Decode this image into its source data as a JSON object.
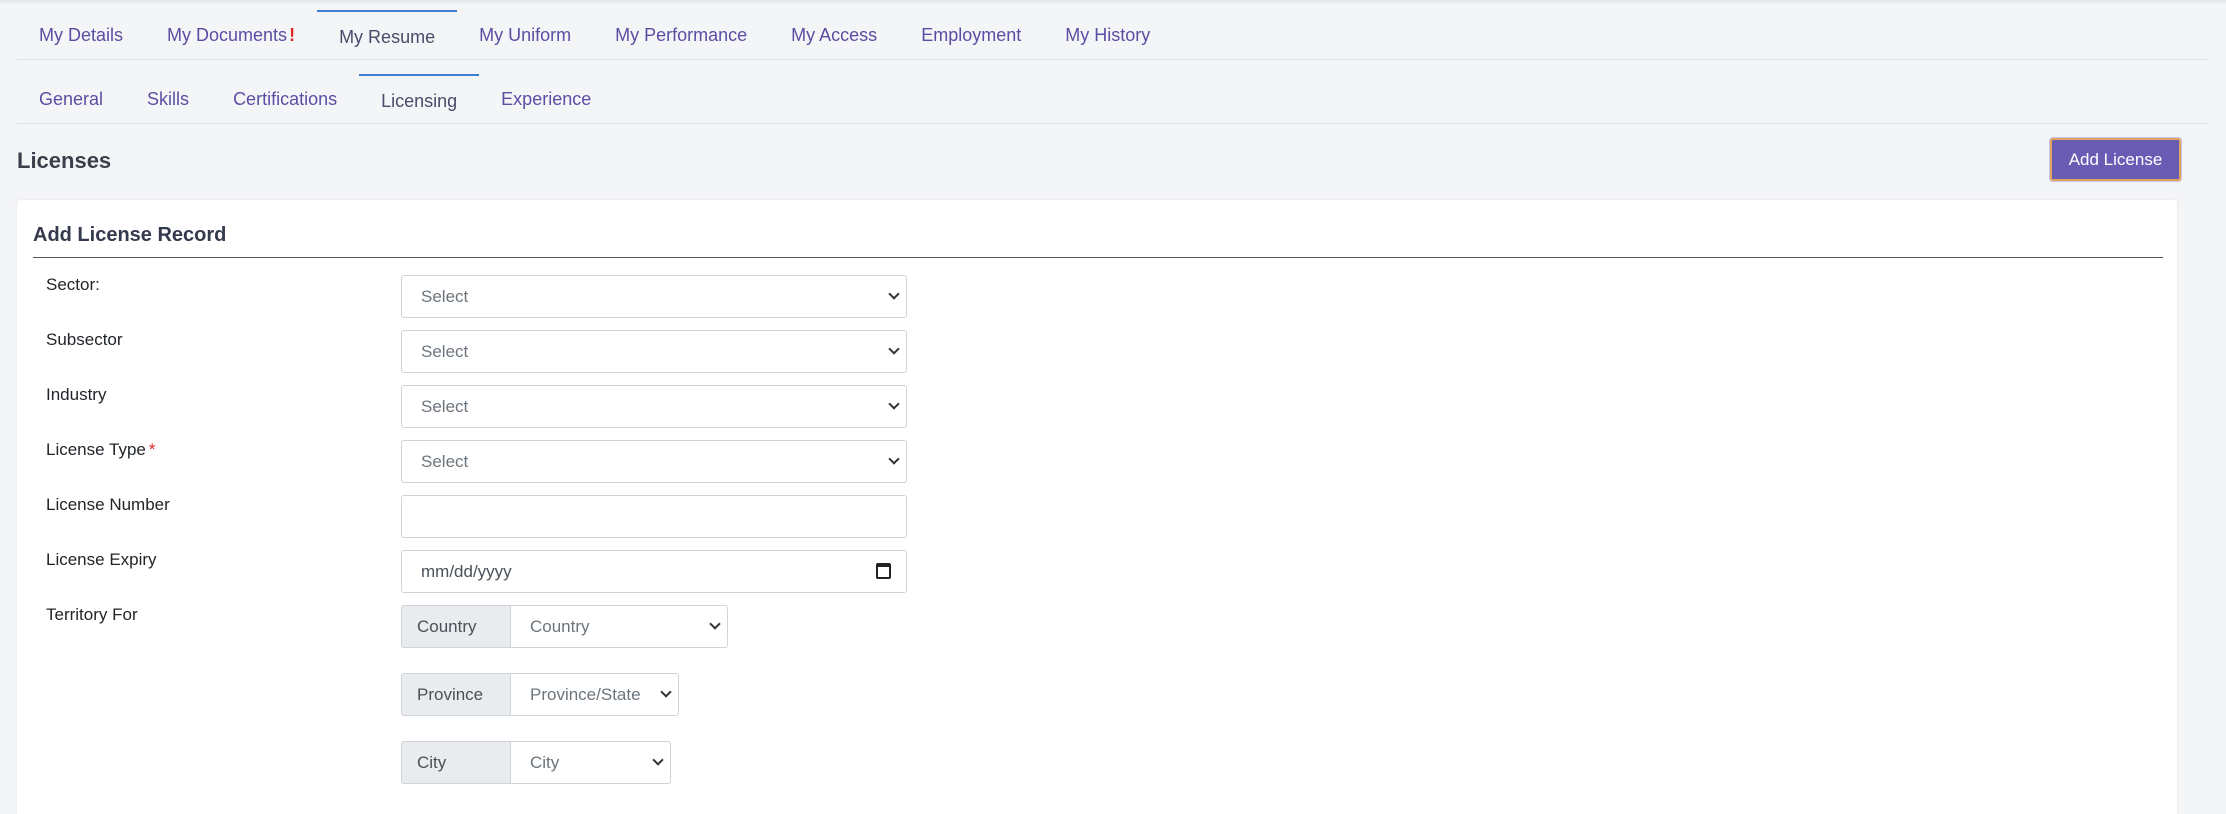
{
  "main_tabs": [
    {
      "label": "My Details"
    },
    {
      "label": "My Documents",
      "alert": "!"
    },
    {
      "label": "My Resume"
    },
    {
      "label": "My Uniform"
    },
    {
      "label": "My Performance"
    },
    {
      "label": "My Access"
    },
    {
      "label": "Employment"
    },
    {
      "label": "My History"
    }
  ],
  "main_active": "My Resume",
  "sub_tabs": [
    {
      "label": "General"
    },
    {
      "label": "Skills"
    },
    {
      "label": "Certifications"
    },
    {
      "label": "Licensing"
    },
    {
      "label": "Experience"
    }
  ],
  "sub_active": "Licensing",
  "section": {
    "title": "Licenses",
    "add_button": "Add License"
  },
  "form": {
    "title": "Add License Record",
    "fields": [
      {
        "label": "Sector:",
        "value": "Select",
        "required": false
      },
      {
        "label": "Subsector",
        "value": "Select",
        "required": false
      },
      {
        "label": "Industry",
        "value": "Select",
        "required": false
      },
      {
        "label": "License Type",
        "value": "Select",
        "required": true,
        "required_mark": "*"
      },
      {
        "label": "License Number",
        "value": "",
        "required": false
      },
      {
        "label": "License Expiry",
        "placeholder": "mm/dd/yyyy",
        "required": false
      }
    ],
    "territory": {
      "label": "Territory For",
      "country": {
        "label": "Country",
        "value": "Country"
      },
      "province": {
        "label": "Province",
        "value": "Province/State"
      },
      "city": {
        "label": "City",
        "value": "City"
      }
    }
  },
  "colors": {
    "accent": "#6a5bb5",
    "tab_text": "#5a4ea3",
    "active_border": "#3d7fd6",
    "required": "#e02424"
  }
}
